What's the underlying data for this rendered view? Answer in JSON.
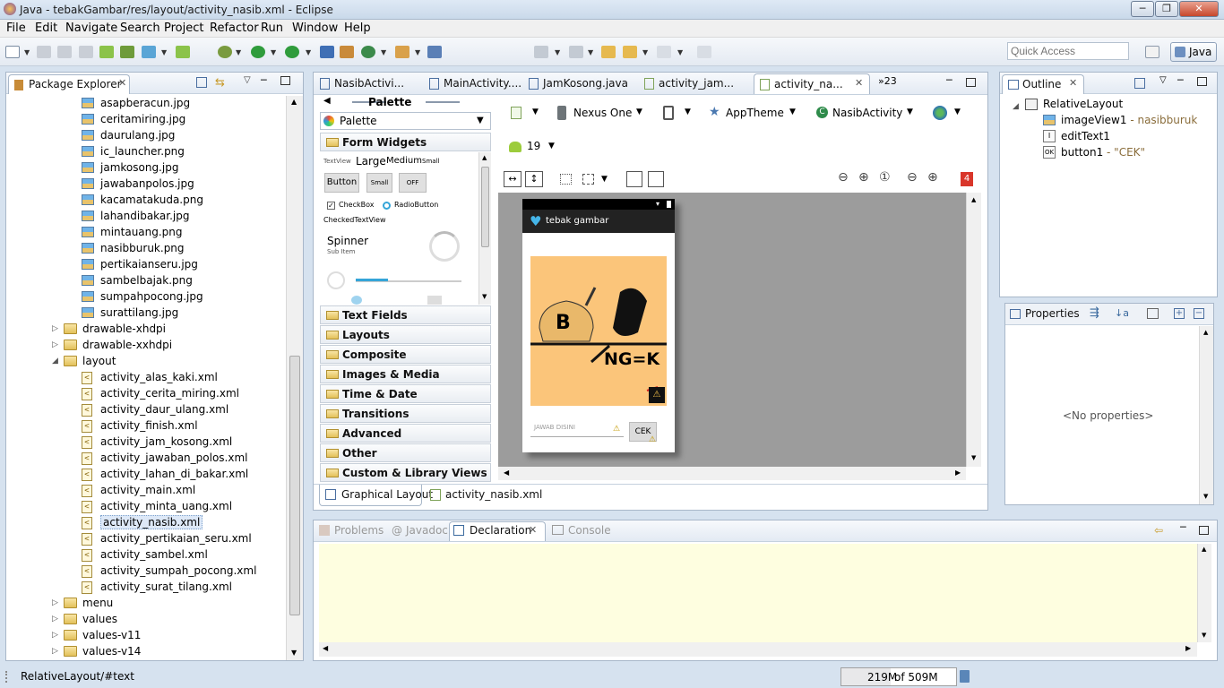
{
  "window": {
    "title": "Java - tebakGambar/res/layout/activity_nasib.xml - Eclipse",
    "min": "─",
    "max": "❐",
    "close": "✕"
  },
  "menu": [
    "File",
    "Edit",
    "Navigate",
    "Search",
    "Project",
    "Refactor",
    "Run",
    "Window",
    "Help"
  ],
  "toolbar": {
    "quick_access_placeholder": "Quick Access",
    "perspective": "Java"
  },
  "package_explorer": {
    "title": "Package Explorer",
    "images": [
      "asapberacun.jpg",
      "ceritamiring.jpg",
      "daurulang.jpg",
      "ic_launcher.png",
      "jamkosong.jpg",
      "jawabanpolos.jpg",
      "kacamatakuda.png",
      "lahandibakar.jpg",
      "mintauang.png",
      "nasibburuk.png",
      "pertikaianseru.jpg",
      "sambelbajak.png",
      "sumpahpocong.jpg",
      "surattilang.jpg"
    ],
    "folders_a": [
      "drawable-xhdpi",
      "drawable-xxhdpi"
    ],
    "layout_folder": "layout",
    "layout_files": [
      "activity_alas_kaki.xml",
      "activity_cerita_miring.xml",
      "activity_daur_ulang.xml",
      "activity_finish.xml",
      "activity_jam_kosong.xml",
      "activity_jawaban_polos.xml",
      "activity_lahan_di_bakar.xml",
      "activity_main.xml",
      "activity_minta_uang.xml",
      "activity_nasib.xml",
      "activity_pertikaian_seru.xml",
      "activity_sambel.xml",
      "activity_sumpah_pocong.xml",
      "activity_surat_tilang.xml"
    ],
    "folders_b": [
      "menu",
      "values",
      "values-v11",
      "values-v14"
    ],
    "selected": "activity_nasib.xml"
  },
  "editor": {
    "tabs": [
      "NasibActivi...",
      "MainActivity....",
      "JamKosong.java",
      "activity_jam...",
      "activity_na..."
    ],
    "overflow": "»23",
    "palette": {
      "title": "Palette",
      "dropdown": "Palette",
      "sections": [
        "Form Widgets",
        "Text Fields",
        "Layouts",
        "Composite",
        "Images & Media",
        "Time & Date",
        "Transitions",
        "Advanced",
        "Other",
        "Custom & Library Views"
      ],
      "preview": {
        "textview": "TextView",
        "large": "Large",
        "medium": "Medium",
        "small": "Small",
        "button": "Button",
        "small_btn": "Small",
        "off": "OFF",
        "checkbox": "CheckBox",
        "radio": "RadioButton",
        "checked_tv": "CheckedTextView",
        "spinner": "Spinner",
        "sub_item": "Sub Item"
      }
    },
    "config": {
      "device": "Nexus One",
      "theme": "AppTheme",
      "activity": "NasibActivity",
      "api": "19",
      "error_count": "4"
    },
    "device_preview": {
      "app_title": "tebak gambar",
      "puzzle_letter": "B",
      "puzzle_text": "NG=K",
      "input_hint": "JAWAB DISINI",
      "button": "CEK"
    },
    "bottom_tabs": [
      "Graphical Layout",
      "activity_nasib.xml"
    ]
  },
  "outline": {
    "title": "Outline",
    "root": "RelativeLayout",
    "items": [
      {
        "name": "imageView1",
        "detail": " - nasibburuk"
      },
      {
        "name": "editText1",
        "detail": ""
      },
      {
        "name": "button1",
        "detail": " - \"CEK\""
      }
    ]
  },
  "properties": {
    "title": "Properties",
    "empty": "<No properties>"
  },
  "bottom_panel": {
    "tabs": [
      "Problems",
      "Javadoc",
      "Declaration",
      "Console"
    ],
    "active": "Declaration"
  },
  "status": {
    "path": "RelativeLayout/#text",
    "memory_used": "219M",
    "memory_total": "of 509M",
    "memory_fraction": 0.43
  }
}
